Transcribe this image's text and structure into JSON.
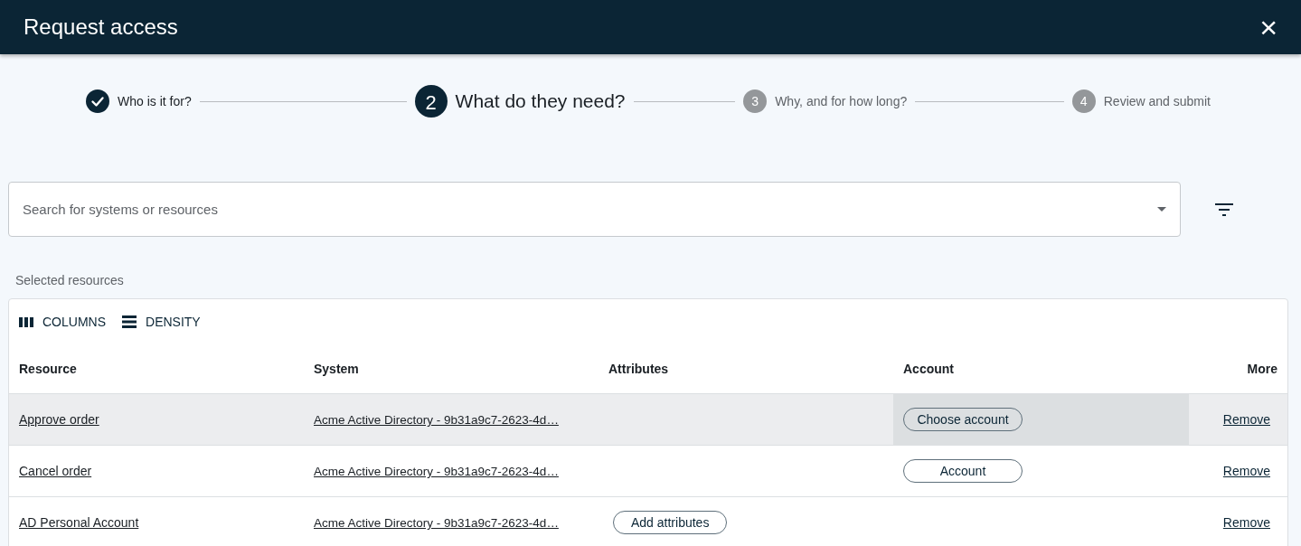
{
  "dialog": {
    "title": "Request access",
    "close": "×"
  },
  "steps": [
    {
      "label": "Who is it for?",
      "completed": true,
      "selected": false
    },
    {
      "number": "2",
      "label": "What do they need?",
      "completed": false,
      "selected": true
    },
    {
      "number": "3",
      "label": "Why, and for how long?",
      "completed": false,
      "selected": false
    },
    {
      "number": "4",
      "label": "Review and submit",
      "completed": false,
      "selected": false
    }
  ],
  "search": {
    "placeholder": "Search for systems or resources"
  },
  "section_label": "Selected resources",
  "toolbar": [
    {
      "kind": "columns",
      "label": "COLUMNS"
    },
    {
      "kind": "density",
      "label": "DENSITY"
    }
  ],
  "table": {
    "columns": [
      "Resource",
      "System",
      "Attributes",
      "Account",
      "More"
    ],
    "rows": [
      {
        "resource": "Approve order",
        "system": "Acme Active Directory - 9b31a9c7-2623-4d…",
        "attributes_button": null,
        "account_button": "Choose account",
        "more": "Remove",
        "highlighted": true
      },
      {
        "resource": "Cancel order",
        "system": "Acme Active Directory - 9b31a9c7-2623-4d…",
        "attributes_button": null,
        "account_button": "Account",
        "more": "Remove",
        "highlighted": false
      },
      {
        "resource": "AD Personal Account",
        "system": "Acme Active Directory - 9b31a9c7-2623-4d…",
        "attributes_button": "Add attributes",
        "account_button": null,
        "more": "Remove",
        "highlighted": false
      }
    ]
  }
}
